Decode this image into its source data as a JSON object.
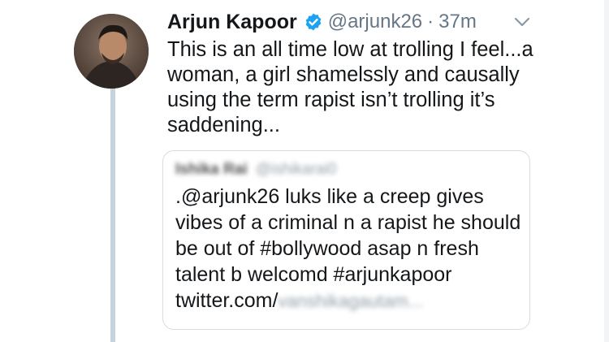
{
  "tweet": {
    "author_name": "Arjun Kapoor",
    "handle": "@arjunk26",
    "separator": "·",
    "time": "37m",
    "text": "This is an all time low at trolling I feel...a woman, a girl shamelssly and causally using the term rapist isn’t trolling it’s saddening...",
    "icons": {
      "verified": "verified-badge-icon",
      "menu": "chevron-down-icon"
    },
    "colors": {
      "verified": "#1da1f2",
      "secondary_text": "#657786",
      "thread_line": "#c6d3de"
    }
  },
  "quoted_tweet": {
    "author_name": "Ishika Rai",
    "handle": "@ishikarai0",
    "text": ".@arjunk26 luks like a creep gives vibes of a criminal n a rapist he should be out of #bollywood asap n fresh talent b welcomd #arjunkapoor",
    "link_prefix": "twitter.com/",
    "link_blurred": "vanshikagautam..."
  }
}
